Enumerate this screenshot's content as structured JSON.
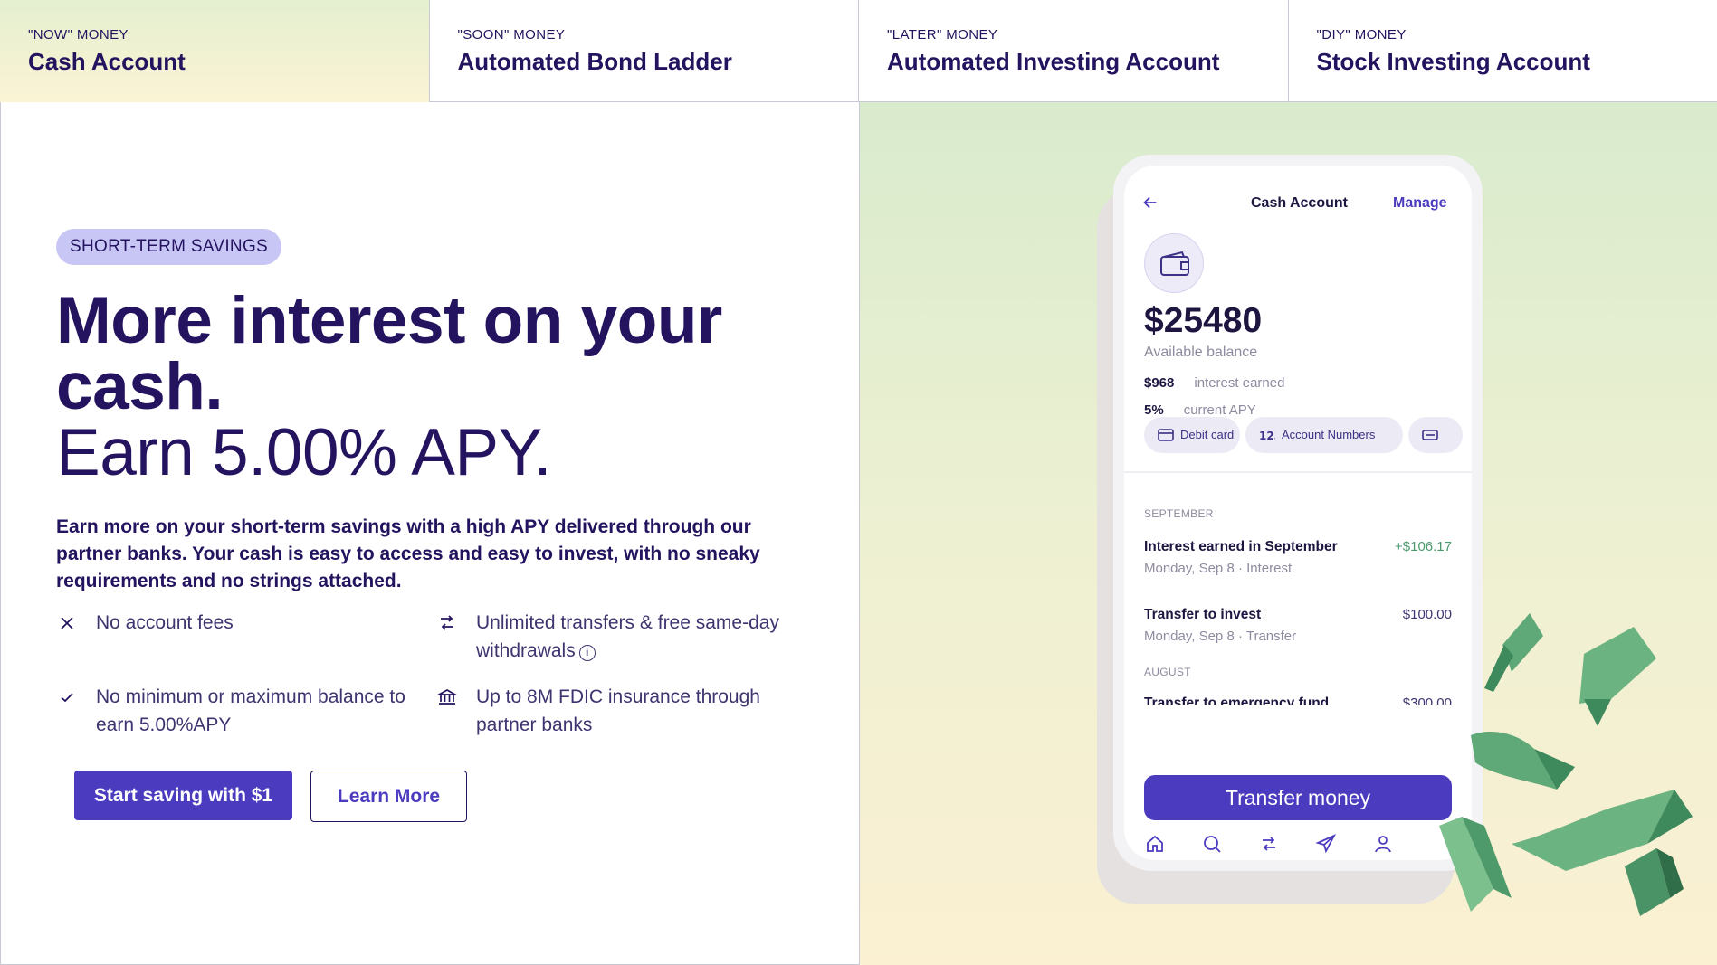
{
  "tabs": [
    {
      "kicker": "\"NOW\" MONEY",
      "name": "Cash Account"
    },
    {
      "kicker": "\"SOON\" MONEY",
      "name": "Automated Bond Ladder"
    },
    {
      "kicker": "\"LATER\" MONEY",
      "name": "Automated Investing Account"
    },
    {
      "kicker": "\"DIY\" MONEY",
      "name": "Stock Investing Account"
    }
  ],
  "hero": {
    "badge": "SHORT-TERM SAVINGS",
    "headline_bold": "More interest on your cash.",
    "headline_light": "Earn 5.00% APY.",
    "description": "Earn more on your short-term savings with a high APY delivered through our partner banks. Your cash is easy to access and easy to invest, with no sneaky requirements and no strings attached."
  },
  "features": [
    {
      "icon": "x-icon",
      "text": "No account fees"
    },
    {
      "icon": "transfer-arrows-icon",
      "text": "Unlimited transfers & free same-day withdrawals"
    },
    {
      "icon": "check-icon",
      "text": "No minimum or maximum balance to earn 5.00%APY"
    },
    {
      "icon": "bank-icon",
      "text": "Up to 8M FDIC insurance through partner banks"
    }
  ],
  "buttons": {
    "primary": "Start saving with $1",
    "secondary": "Learn More"
  },
  "phone": {
    "title": "Cash Account",
    "manage": "Manage",
    "balance": "$25480",
    "balance_label": "Available balance",
    "interest_value": "$968",
    "interest_label": "interest earned",
    "apy_value": "5%",
    "apy_label": "current APY",
    "chips": [
      "Debit card",
      "Account Numbers"
    ],
    "months": [
      "SEPTEMBER",
      "AUGUST"
    ],
    "transactions": [
      {
        "name": "Interest earned in September",
        "sub": "Monday, Sep 8 · Interest",
        "amount": "+$106.17"
      },
      {
        "name": "Transfer to invest",
        "sub": "Monday, Sep 8 · Transfer",
        "amount": "$100.00"
      },
      {
        "name": "Transfer to emergency fund",
        "sub": "",
        "amount": "$300.00"
      }
    ],
    "transfer_button": "Transfer money",
    "nav": [
      "home-icon",
      "search-icon",
      "transfer-icon",
      "send-icon",
      "profile-icon"
    ]
  },
  "colors": {
    "brand_navy": "#24135f",
    "primary_purple": "#4b3bbf",
    "badge_lavender": "#c8c6f5",
    "positive_green": "#4a9a6e"
  }
}
